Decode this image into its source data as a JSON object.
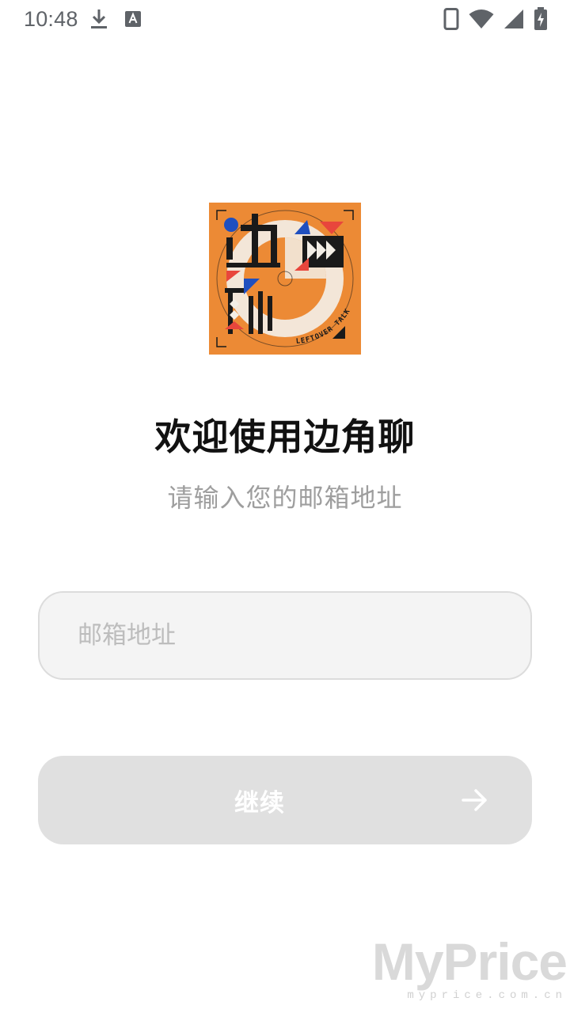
{
  "status_bar": {
    "time": "10:48",
    "left_icons": [
      "download-icon",
      "keyboard-a-icon"
    ],
    "right_icons": [
      "phone-icon",
      "wifi-icon",
      "cell-signal-icon",
      "battery-charging-icon"
    ]
  },
  "logo": {
    "text_top_left": "边",
    "text_top_right": "角",
    "text_bottom_left": "聊",
    "ring_text": "LEFTOVER TALK",
    "colors": {
      "background": "#ec8a35",
      "blue": "#1f4fbf",
      "red": "#e8463c",
      "black": "#1a1a1a",
      "cream": "#f3eee6"
    }
  },
  "welcome": {
    "title": "欢迎使用边角聊",
    "subtitle": "请输入您的邮箱地址"
  },
  "email": {
    "placeholder": "邮箱地址",
    "value": ""
  },
  "continue_button": {
    "label": "继续",
    "icon": "arrow-right-icon"
  },
  "watermark": {
    "main": "MyPrice",
    "sub": "myprice.com.cn"
  },
  "colors": {
    "title": "#111111",
    "subtitle": "#9e9e9e",
    "input_bg": "#f4f4f4",
    "input_border": "#dcdcdc",
    "button_disabled": "#e0e0e0"
  }
}
